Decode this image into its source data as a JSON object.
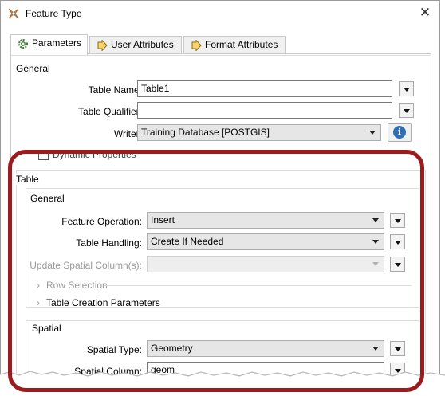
{
  "window": {
    "title": "Feature Type",
    "close_glyph": "✕"
  },
  "tabs": [
    {
      "label": "Parameters",
      "icon": "gear-icon",
      "active": true
    },
    {
      "label": "User Attributes",
      "icon": "arrow-right-icon",
      "active": false
    },
    {
      "label": "Format Attributes",
      "icon": "arrow-right-icon",
      "active": false
    }
  ],
  "general": {
    "label": "General",
    "table_name_label": "Table Name:",
    "table_name_value": "Table1",
    "table_qualifier_label": "Table Qualifier:",
    "table_qualifier_value": "",
    "writer_label": "Writer:",
    "writer_value": "Training Database [POSTGIS]",
    "dynamic_properties_label": "Dynamic Properties"
  },
  "table": {
    "label": "Table",
    "general_label": "General",
    "feature_operation_label": "Feature Operation:",
    "feature_operation_value": "Insert",
    "table_handling_label": "Table Handling:",
    "table_handling_value": "Create If Needed",
    "update_spatial_label": "Update Spatial Column(s):",
    "update_spatial_value": "",
    "row_selection_label": "Row Selection",
    "table_creation_label": "Table Creation Parameters",
    "spatial_label": "Spatial",
    "spatial_type_label": "Spatial Type:",
    "spatial_type_value": "Geometry",
    "spatial_column_label": "Spatial Column:",
    "spatial_column_value": "geom"
  },
  "colors": {
    "highlight": "#9c1b1f",
    "info": "#2f6db5"
  }
}
